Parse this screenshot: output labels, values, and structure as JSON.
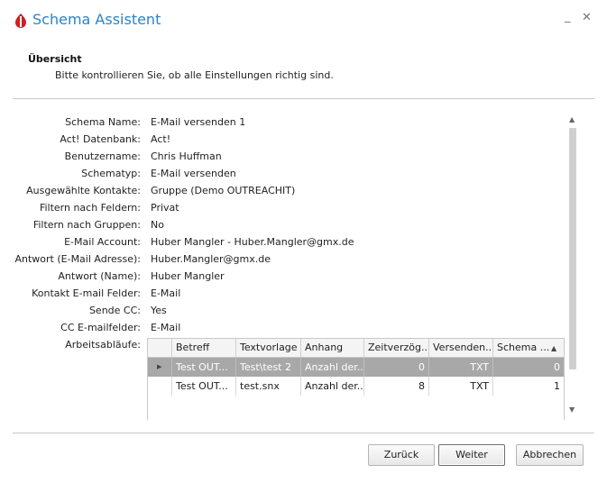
{
  "window": {
    "title": "Schema Assistent",
    "minimize_glyph": "_",
    "close_glyph": "✕"
  },
  "header": {
    "title": "Übersicht",
    "subtitle": "Bitte kontrollieren Sie, ob alle Einstellungen richtig sind."
  },
  "fields": [
    {
      "label": "Schema Name:",
      "value": "E-Mail versenden 1"
    },
    {
      "label": "Act! Datenbank:",
      "value": "Act!"
    },
    {
      "label": "Benutzername:",
      "value": "Chris Huffman"
    },
    {
      "label": "Schematyp:",
      "value": "E-Mail versenden"
    },
    {
      "label": "Ausgewählte Kontakte:",
      "value": "Gruppe (Demo OUTREACHIT)"
    },
    {
      "label": "Filtern nach Feldern:",
      "value": "Privat"
    },
    {
      "label": "Filtern nach Gruppen:",
      "value": "No"
    },
    {
      "label": "E-Mail Account:",
      "value": "Huber Mangler - Huber.Mangler@gmx.de"
    },
    {
      "label": "Antwort (E-Mail Adresse):",
      "value": "Huber.Mangler@gmx.de"
    },
    {
      "label": "Antwort (Name):",
      "value": "Huber Mangler"
    },
    {
      "label": "Kontakt E-mail Felder:",
      "value": "E-Mail"
    },
    {
      "label": "Sende CC:",
      "value": "Yes"
    },
    {
      "label": "CC E-mailfelder:",
      "value": "E-Mail"
    },
    {
      "label": "Arbeitsabläufe:",
      "value": ""
    }
  ],
  "workflow_table": {
    "columns": [
      "Betreff",
      "Textvorlage",
      "Anhang",
      "Zeitverzög...",
      "Versenden...",
      "Schema ..."
    ],
    "rows": [
      {
        "selected": true,
        "cells": [
          "Test OUT...",
          "Test\\test 2",
          "Anzahl der...",
          "0",
          "TXT",
          "0"
        ]
      },
      {
        "selected": false,
        "cells": [
          "Test OUT...",
          "test.snx",
          "Anzahl der...",
          "8",
          "TXT",
          "1"
        ]
      }
    ],
    "sort_glyph": "▲",
    "row_indicator_glyph": "▶"
  },
  "buttons": {
    "back": "Zurück",
    "next": "Weiter",
    "cancel": "Abbrechen"
  },
  "colors": {
    "accent": "#2a83c6",
    "brand_icon": "#cc2020",
    "selected_row": "#a8a8a8"
  }
}
